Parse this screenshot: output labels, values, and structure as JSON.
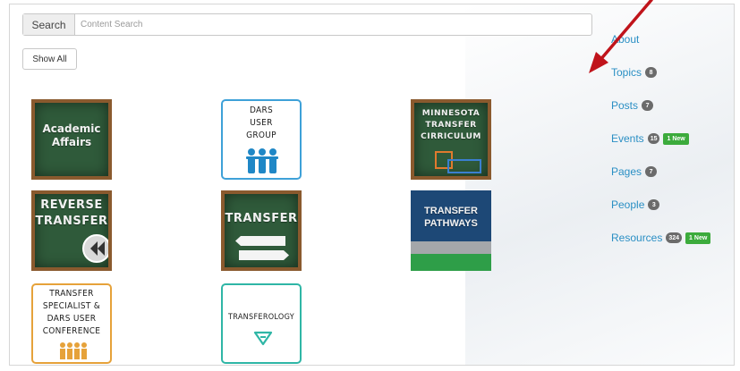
{
  "search": {
    "label": "Search",
    "placeholder": "Content Search"
  },
  "show_all_label": "Show All",
  "tiles": [
    {
      "name": "academic-affairs",
      "lines": [
        "Academic",
        "Affairs"
      ]
    },
    {
      "name": "dars-user-group",
      "lines": [
        "DARS",
        "USER",
        "GROUP"
      ]
    },
    {
      "name": "minnesota-transfer-curriculum",
      "lines": [
        "MINNESOTA",
        "TRANSFER",
        "CIRRICULUM"
      ]
    },
    {
      "name": "reverse-transfer",
      "lines": [
        "REVERSE",
        "TRANSFER"
      ]
    },
    {
      "name": "transfer",
      "lines": [
        "TRANSFER"
      ]
    },
    {
      "name": "transfer-pathways",
      "lines": [
        "TRANSFER",
        "PATHWAYS"
      ]
    },
    {
      "name": "transfer-specialist-conference",
      "lines": [
        "TRANSFER",
        "SPECIALIST &",
        "DARS USER",
        "CONFERENCE"
      ]
    },
    {
      "name": "transferology",
      "lines": [
        "TRANSFEROLOGY"
      ]
    }
  ],
  "sidebar": {
    "items": [
      {
        "label": "About",
        "count": "",
        "new": ""
      },
      {
        "label": "Topics",
        "count": "8",
        "new": ""
      },
      {
        "label": "Posts",
        "count": "7",
        "new": ""
      },
      {
        "label": "Events",
        "count": "15",
        "new": "1 New"
      },
      {
        "label": "Pages",
        "count": "7",
        "new": ""
      },
      {
        "label": "People",
        "count": "3",
        "new": ""
      },
      {
        "label": "Resources",
        "count": "324",
        "new": "1 New"
      }
    ]
  },
  "colors": {
    "link": "#2a8fc4",
    "badge": "#6b6b6b",
    "new_badge": "#3cab3c",
    "annotation_arrow": "#c0141b"
  }
}
